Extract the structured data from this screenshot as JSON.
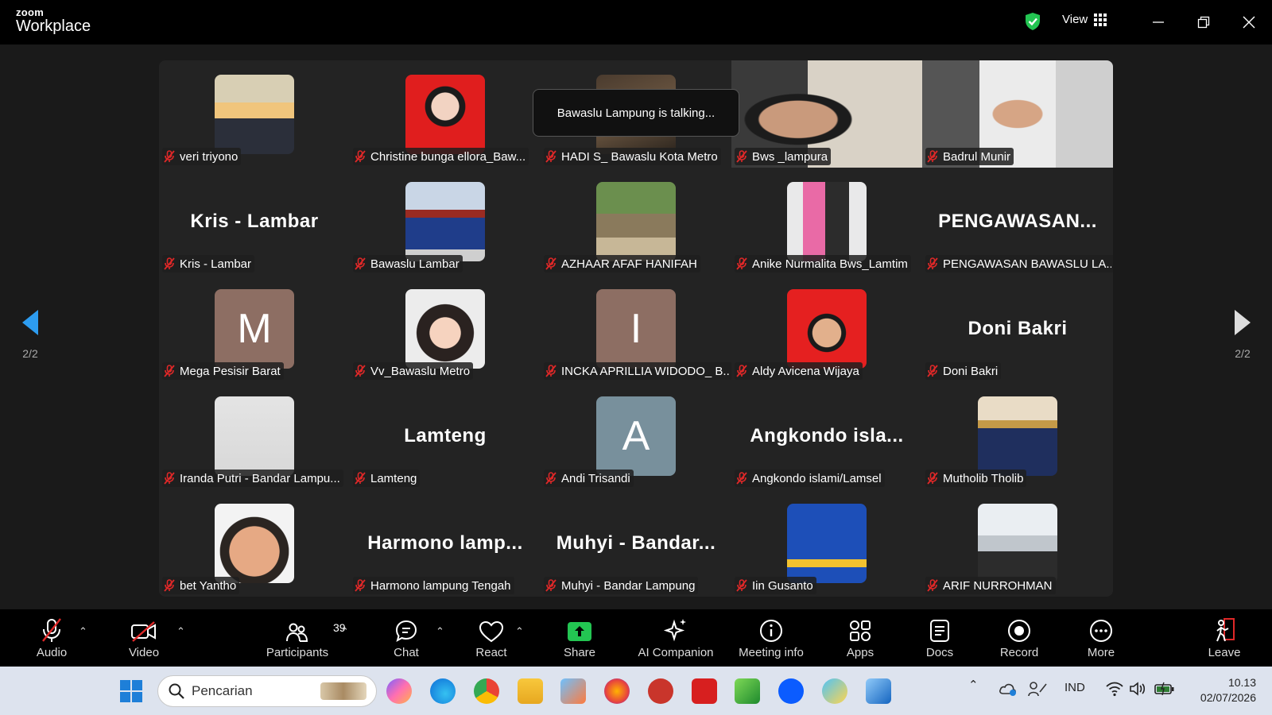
{
  "app": {
    "brand_small": "zoom",
    "brand_big": "Workplace",
    "view_label": "View"
  },
  "toast": "Bawaslu Lampung is talking...",
  "pager": {
    "left": "2/2",
    "right": "2/2"
  },
  "participants": [
    {
      "name": "veri triyono",
      "kind": "photo",
      "photo": "man-office"
    },
    {
      "name": "Christine bunga ellora_Baw...",
      "kind": "photo",
      "photo": "woman-red"
    },
    {
      "name": "HADI S_ Bawaslu Kota Metro",
      "kind": "photo",
      "photo": "man-dark"
    },
    {
      "name": "Bws _lampura",
      "kind": "video",
      "photo": "video-young-man"
    },
    {
      "name": "Badrul Munir",
      "kind": "video",
      "photo": "video-man-glasses"
    },
    {
      "name": "Kris - Lambar",
      "kind": "text",
      "display": "Kris - Lambar"
    },
    {
      "name": "Bawaslu Lambar",
      "kind": "photo",
      "photo": "group-blue"
    },
    {
      "name": "AZHAAR AFAF HANIFAH",
      "kind": "photo",
      "photo": "outdoor"
    },
    {
      "name": "Anike Nurmalita Bws_Lamtim",
      "kind": "photo",
      "photo": "two-women"
    },
    {
      "name": "PENGAWASAN BAWASLU LA...",
      "kind": "text",
      "display": "PENGAWASAN..."
    },
    {
      "name": "Mega Pesisir Barat",
      "kind": "initial",
      "initial": "M",
      "color": "#8d6e63"
    },
    {
      "name": "Vv_Bawaslu Metro",
      "kind": "photo",
      "photo": "cartoon-hijab"
    },
    {
      "name": "INCKA APRILLIA WIDODO_ B...",
      "kind": "initial",
      "initial": "I",
      "color": "#8d6e63"
    },
    {
      "name": "Aldy Avicena Wijaya",
      "kind": "photo",
      "photo": "man-red"
    },
    {
      "name": "Doni Bakri",
      "kind": "text",
      "display": "Doni Bakri"
    },
    {
      "name": "Iranda Putri - Bandar Lampu...",
      "kind": "photo",
      "photo": "blank-white"
    },
    {
      "name": "Lamteng",
      "kind": "text",
      "display": "Lamteng"
    },
    {
      "name": "Andi Trisandi",
      "kind": "initial",
      "initial": "A",
      "color": "#78909c"
    },
    {
      "name": "Angkondo islami/Lamsel",
      "kind": "text",
      "display": "Angkondo  isla..."
    },
    {
      "name": "Mutholib Tholib",
      "kind": "photo",
      "photo": "man-traditional"
    },
    {
      "name": "bet Yantho",
      "kind": "photo",
      "photo": "face-closeup"
    },
    {
      "name": "Harmono lampung Tengah",
      "kind": "text",
      "display": "Harmono  lamp..."
    },
    {
      "name": "Muhyi - Bandar Lampung",
      "kind": "text",
      "display": "Muhyi  -  Bandar..."
    },
    {
      "name": "Iin Gusanto",
      "kind": "photo",
      "photo": "poster-blue"
    },
    {
      "name": "ARIF NURROHMAN",
      "kind": "photo",
      "photo": "man-building"
    }
  ],
  "toolbar": {
    "audio": "Audio",
    "video": "Video",
    "participants": "Participants",
    "participant_count": "39",
    "chat": "Chat",
    "react": "React",
    "share": "Share",
    "ai_companion": "AI Companion",
    "meeting_info": "Meeting info",
    "apps": "Apps",
    "docs": "Docs",
    "record": "Record",
    "more": "More",
    "leave": "Leave"
  },
  "taskbar": {
    "search_placeholder": "Pencarian",
    "lang": "IND",
    "time": "10.13",
    "date": "02/07/2026"
  },
  "colors": {
    "share_green": "#23c552",
    "leave_red": "#e02828",
    "muted_red": "#e02828",
    "shield_green": "#23c552"
  }
}
